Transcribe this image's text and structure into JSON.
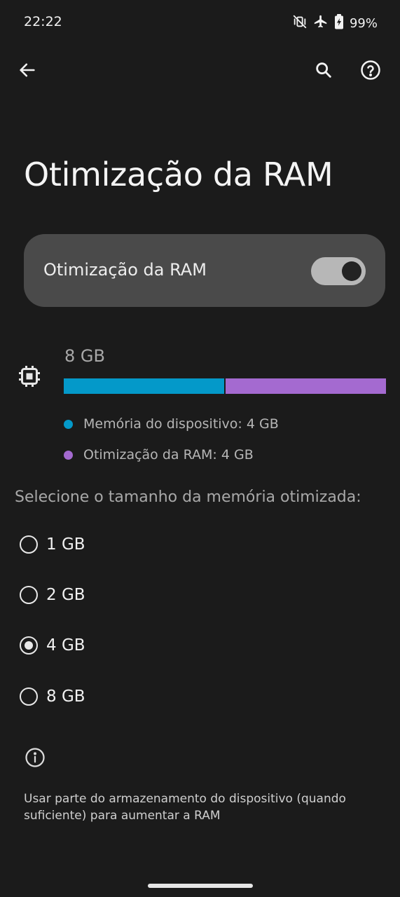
{
  "status_bar": {
    "time": "22:22",
    "battery": "99%",
    "icons": [
      "mute-vibrate-icon",
      "airplane-icon",
      "battery-charging-icon"
    ]
  },
  "top_bar": {
    "icons": [
      "back-arrow-icon",
      "search-icon",
      "help-icon"
    ]
  },
  "page": {
    "title": "Otimização da RAM"
  },
  "toggle": {
    "label": "Otimização da RAM",
    "state": "on"
  },
  "memory": {
    "icon": "memory-chip-icon",
    "total": "8 GB",
    "bar": {
      "device_fraction": 0.5,
      "optimization_fraction": 0.5
    },
    "legend": [
      {
        "label": "Memória do dispositivo: 4 GB",
        "color": "#0499c9"
      },
      {
        "label": "Otimização da RAM: 4 GB",
        "color": "#a46ad0"
      }
    ]
  },
  "selection": {
    "heading": "Selecione o tamanho da memória otimizada:",
    "options": [
      {
        "label": "1 GB",
        "selected": false
      },
      {
        "label": "2 GB",
        "selected": false
      },
      {
        "label": "4 GB",
        "selected": true
      },
      {
        "label": "8 GB",
        "selected": false
      }
    ]
  },
  "info": {
    "icon": "info-icon",
    "text": "Usar parte do armazenamento do dispositivo (quando suficiente) para aumentar a RAM"
  },
  "colors": {
    "background": "#1b1b1b",
    "card": "#4a4a4a",
    "device_bar": "#0499c9",
    "optimization_bar": "#a46ad0"
  }
}
